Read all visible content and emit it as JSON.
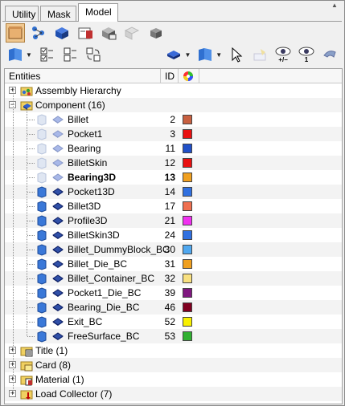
{
  "tabs": [
    {
      "label": "Utility",
      "active": false
    },
    {
      "label": "Mask",
      "active": false
    },
    {
      "label": "Model",
      "active": true
    }
  ],
  "toolbar1": {
    "icons": [
      "component-view-icon",
      "assembly-view-icon",
      "solid-view-icon",
      "material-view-icon",
      "property-view-icon",
      "element-view-icon",
      "load-view-icon"
    ]
  },
  "toolbar2": {
    "icons": [
      "display-mode-icon",
      "select-all-icon",
      "select-none-icon",
      "reverse-selection-icon",
      "shaded-mode-icon",
      "wireframe-mode-icon",
      "pointer-icon",
      "isolate-icon",
      "show-hide-toggle-icon",
      "show-only-icon",
      "undo-icon"
    ],
    "labels": {
      "toggle_label": "+/−",
      "only_label": "1"
    }
  },
  "tree": {
    "headers": {
      "entities": "Entities",
      "id": "ID",
      "color": "color-wheel-icon"
    },
    "groups": [
      {
        "label": "Assembly Hierarchy",
        "expanded": false
      },
      {
        "label": "Component (16)",
        "expanded": true
      },
      {
        "label": "Title (1)",
        "expanded": false
      },
      {
        "label": "Card (8)",
        "expanded": false
      },
      {
        "label": "Material (1)",
        "expanded": false
      },
      {
        "label": "Load Collector (7)",
        "expanded": false
      }
    ],
    "components": [
      {
        "name": "Billet",
        "id": "2",
        "color": "#c86040",
        "state": "hidden",
        "bold": false
      },
      {
        "name": "Pocket1",
        "id": "3",
        "color": "#e81010",
        "state": "hidden",
        "bold": false
      },
      {
        "name": "Bearing",
        "id": "11",
        "color": "#2050c8",
        "state": "hidden",
        "bold": false
      },
      {
        "name": "BilletSkin",
        "id": "12",
        "color": "#e81010",
        "state": "hidden",
        "bold": false
      },
      {
        "name": "Bearing3D",
        "id": "13",
        "color": "#f0a020",
        "state": "hidden",
        "bold": true
      },
      {
        "name": "Pocket13D",
        "id": "14",
        "color": "#3070e0",
        "state": "shown",
        "bold": false
      },
      {
        "name": "Billet3D",
        "id": "17",
        "color": "#f07050",
        "state": "shown",
        "bold": false
      },
      {
        "name": "Profile3D",
        "id": "21",
        "color": "#f030f0",
        "state": "shown",
        "bold": false
      },
      {
        "name": "BilletSkin3D",
        "id": "24",
        "color": "#3070e0",
        "state": "shown",
        "bold": false
      },
      {
        "name": "Billet_DummyBlock_BC",
        "id": "30",
        "color": "#50a8f0",
        "state": "shown",
        "bold": false
      },
      {
        "name": "Billet_Die_BC",
        "id": "31",
        "color": "#f0a020",
        "state": "shown",
        "bold": false
      },
      {
        "name": "Billet_Container_BC",
        "id": "32",
        "color": "#f8e080",
        "state": "shown",
        "bold": false
      },
      {
        "name": "Pocket1_Die_BC",
        "id": "39",
        "color": "#801880",
        "state": "shown",
        "bold": false
      },
      {
        "name": "Bearing_Die_BC",
        "id": "46",
        "color": "#800020",
        "state": "shown",
        "bold": false
      },
      {
        "name": "Exit_BC",
        "id": "52",
        "color": "#f8f000",
        "state": "shown",
        "bold": false
      },
      {
        "name": "FreeSurface_BC",
        "id": "53",
        "color": "#30b030",
        "state": "shown",
        "bold": false
      }
    ]
  }
}
